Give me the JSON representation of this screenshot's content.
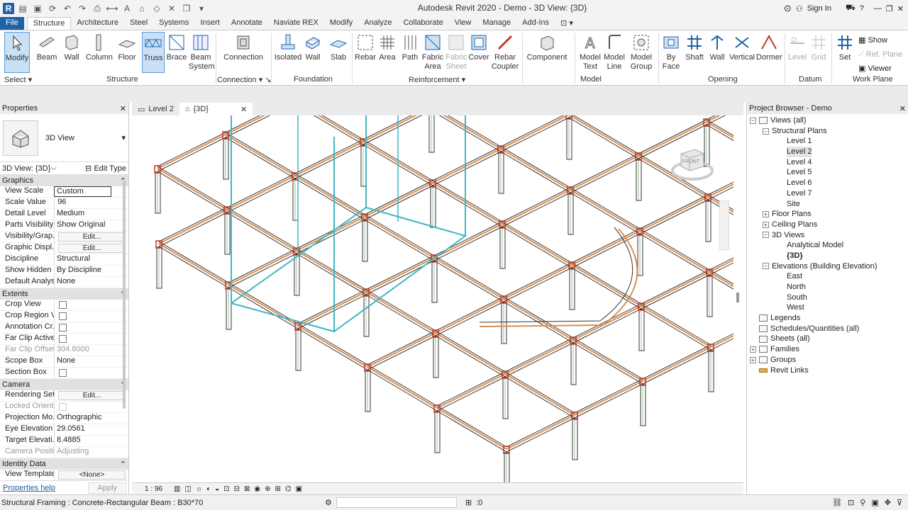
{
  "app": {
    "window_title": "Autodesk Revit 2020 - Demo - 3D View: {3D}",
    "sign_in": "Sign In"
  },
  "tabs": [
    "File",
    "Architecture",
    "Steel",
    "Systems",
    "Insert",
    "Annotate",
    "Naviate REX",
    "Modify",
    "Analyze",
    "Collaborate",
    "View",
    "Manage",
    "Add-Ins"
  ],
  "active_tab_label": "Structure",
  "ribbon": {
    "modify": "Modify",
    "select": "Select",
    "beam": "Beam",
    "wall": "Wall",
    "column": "Column",
    "floor": "Floor",
    "truss": "Truss",
    "brace": "Brace",
    "beam_system_1": "Beam",
    "beam_system_2": "System",
    "structure": "Structure",
    "connection": "Connection",
    "connection_panel": "Connection",
    "isolated": "Isolated",
    "fwall": "Wall",
    "slab": "Slab",
    "foundation": "Foundation",
    "rebar": "Rebar",
    "area": "Area",
    "path": "Path",
    "fabric_area_1": "Fabric",
    "fabric_area_2": "Area",
    "fabric_sheet_1": "Fabric",
    "fabric_sheet_2": "Sheet",
    "cover": "Cover",
    "rebar_coupler_1": "Rebar",
    "rebar_coupler_2": "Coupler",
    "reinforcement": "Reinforcement",
    "component": "Component",
    "model_text_1": "Model",
    "model_text_2": "Text",
    "model_line_1": "Model",
    "model_line_2": "Line",
    "model_group_1": "Model",
    "model_group_2": "Group",
    "model": "Model",
    "by_face_1": "By",
    "by_face_2": "Face",
    "shaft": "Shaft",
    "owall": "Wall",
    "vertical": "Vertical",
    "dormer": "Dormer",
    "opening": "Opening",
    "level": "Level",
    "grid": "Grid",
    "datum": "Datum",
    "set": "Set",
    "show": "Show",
    "ref_plane": "Ref. Plane",
    "viewer": "Viewer",
    "work_plane": "Work Plane"
  },
  "properties": {
    "title": "Properties",
    "type_name": "3D View",
    "instance": "3D View: {3D}",
    "edit_type": "Edit Type",
    "groups": {
      "graphics": "Graphics",
      "extents": "Extents",
      "camera": "Camera",
      "identity": "Identity Data"
    },
    "rows": {
      "view_scale": [
        "View Scale",
        "Custom"
      ],
      "scale_value": [
        "Scale Value",
        "1:",
        "96"
      ],
      "detail_level": [
        "Detail Level",
        "Medium"
      ],
      "parts_visibility": [
        "Parts Visibility",
        "Show Original"
      ],
      "vis_graph": [
        "Visibility/Grap...",
        "Edit..."
      ],
      "graphic_disp": [
        "Graphic Displ...",
        "Edit..."
      ],
      "discipline": [
        "Discipline",
        "Structural"
      ],
      "show_hidden": [
        "Show Hidden ...",
        "By Discipline"
      ],
      "default_analysis": [
        "Default Analys...",
        "None"
      ],
      "crop_view": [
        "Crop View"
      ],
      "crop_region": [
        "Crop Region V..."
      ],
      "annotation_crop": [
        "Annotation Cr..."
      ],
      "far_clip_active": [
        "Far Clip Active"
      ],
      "far_clip_offset": [
        "Far Clip Offset",
        "304.8000"
      ],
      "scope_box": [
        "Scope Box",
        "None"
      ],
      "section_box": [
        "Section Box"
      ],
      "rendering": [
        "Rendering Set...",
        "Edit..."
      ],
      "locked_orient": [
        "Locked Orient..."
      ],
      "projection_mode": [
        "Projection Mo...",
        "Orthographic"
      ],
      "eye_elevation": [
        "Eye Elevation",
        "29.0561"
      ],
      "target_elevation": [
        "Target Elevati...",
        "8.4885"
      ],
      "camera_position": [
        "Camera Positi...",
        "Adjusting"
      ],
      "view_template": [
        "View Template",
        "<None>"
      ]
    },
    "help": "Properties help",
    "apply": "Apply"
  },
  "view_tabs": {
    "level2": "Level 2",
    "3d": "{3D}"
  },
  "view_bar": {
    "scale": "1 : 96"
  },
  "viewcube": {
    "label": "FRONT"
  },
  "browser": {
    "title": "Project Browser - Demo",
    "views_all": "Views (all)",
    "structural_plans": "Structural Plans",
    "levels": [
      "Level 1",
      "Level 2",
      "Level 4",
      "Level 5",
      "Level 6",
      "Level 7",
      "Site"
    ],
    "floor_plans": "Floor Plans",
    "ceiling_plans": "Ceiling Plans",
    "views_3d": "3D Views",
    "analytical": "Analytical Model",
    "v3d": "{3D}",
    "elevations": "Elevations (Building Elevation)",
    "elev": [
      "East",
      "North",
      "South",
      "West"
    ],
    "legends": "Legends",
    "schedules": "Schedules/Quantities (all)",
    "sheets": "Sheets (all)",
    "families": "Families",
    "groups": "Groups",
    "revit_links": "Revit Links"
  },
  "status": {
    "text": "Structural Framing : Concrete-Rectangular Beam : B30*70",
    "zero": ":0"
  },
  "colors": {
    "accent": "#1f62a8",
    "cyan_wall": "#3fb7c4",
    "beam_orange": "#d98e4f"
  }
}
